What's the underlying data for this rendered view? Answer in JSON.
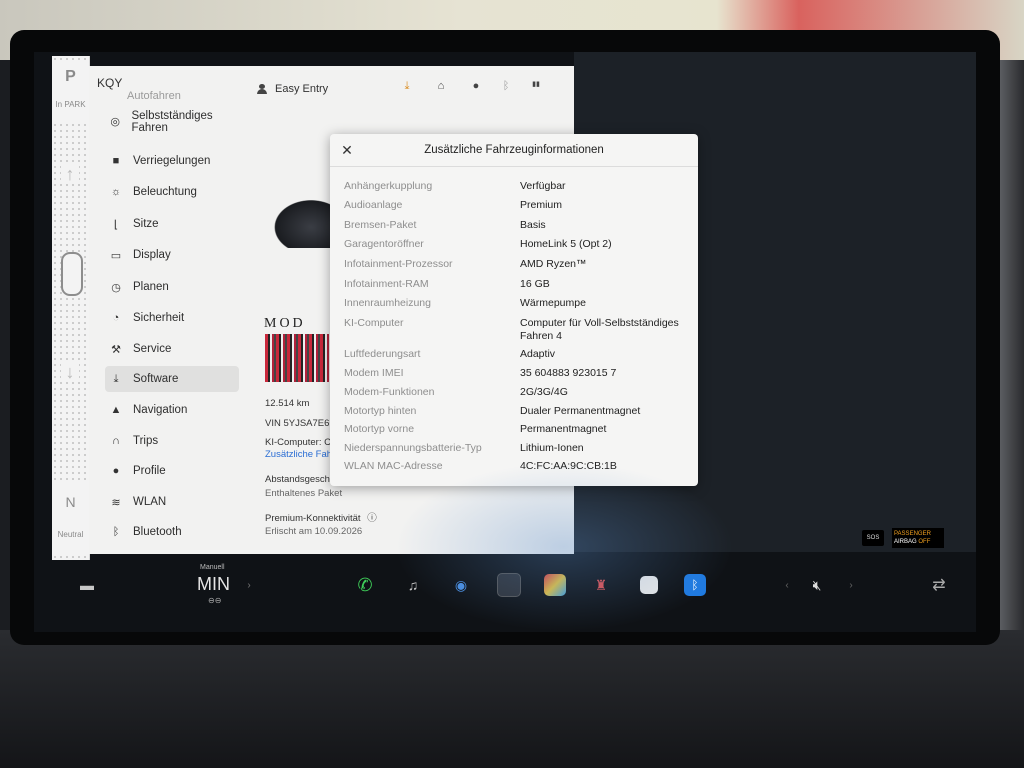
{
  "gear": {
    "park_label": "P",
    "park_sub": "In PARK",
    "neutral_label": "N",
    "neutral_sub": "Neutral"
  },
  "settings": {
    "vehicle_name": "KQY",
    "top_partial": "Autofahren",
    "profile_label": "Easy Entry",
    "menu": [
      {
        "label": "Selbstständiges Fahren",
        "icon": "steering-wheel-icon"
      },
      {
        "label": "Verriegelungen",
        "icon": "lock-icon"
      },
      {
        "label": "Beleuchtung",
        "icon": "light-icon"
      },
      {
        "label": "Sitze",
        "icon": "seat-icon"
      },
      {
        "label": "Display",
        "icon": "display-icon"
      },
      {
        "label": "Planen",
        "icon": "clock-icon"
      },
      {
        "label": "Sicherheit",
        "icon": "shield-icon"
      },
      {
        "label": "Service",
        "icon": "wrench-icon"
      },
      {
        "label": "Software",
        "icon": "download-icon",
        "active": true
      },
      {
        "label": "Navigation",
        "icon": "navigation-icon"
      },
      {
        "label": "Trips",
        "icon": "trips-icon"
      },
      {
        "label": "Profile",
        "icon": "person-icon"
      },
      {
        "label": "WLAN",
        "icon": "wifi-icon"
      },
      {
        "label": "Bluetooth",
        "icon": "bluetooth-icon"
      }
    ],
    "model_logo": "MOD",
    "odometer": "12.514 km",
    "vin": "VIN 5YJSA7E6",
    "ki_computer": "KI-Computer: C",
    "more_info_link": "Zusätzliche Fahr",
    "abstand": "Abstandsgesch",
    "enthalten": "Enthaltenes Paket",
    "premium": "Premium-Konnektivität",
    "expires": "Erlischt am 10.09.2026"
  },
  "dialog": {
    "title": "Zusätzliche Fahrzeuginformationen",
    "rows": [
      {
        "key": "Anhängerkupplung",
        "value": "Verfügbar"
      },
      {
        "key": "Audioanlage",
        "value": "Premium"
      },
      {
        "key": "Bremsen-Paket",
        "value": "Basis"
      },
      {
        "key": "Garagentoröffner",
        "value": "HomeLink 5 (Opt 2)"
      },
      {
        "key": "Infotainment-Prozessor",
        "value": "AMD Ryzen™"
      },
      {
        "key": "Infotainment-RAM",
        "value": "16 GB"
      },
      {
        "key": "Innenraumheizung",
        "value": "Wärmepumpe"
      },
      {
        "key": "KI-Computer",
        "value": "Computer für Voll-Selbstständiges Fahren 4"
      },
      {
        "key": "Luftfederungsart",
        "value": "Adaptiv"
      },
      {
        "key": "Modem IMEI",
        "value": "35 604883 923015 7"
      },
      {
        "key": "Modem-Funktionen",
        "value": "2G/3G/4G"
      },
      {
        "key": "Motortyp hinten",
        "value": "Dualer Permanentmagnet"
      },
      {
        "key": "Motortyp vorne",
        "value": "Permanentmagnet"
      },
      {
        "key": "Niederspannungsbatterie-Typ",
        "value": "Lithium-Ionen"
      },
      {
        "key": "WLAN MAC-Adresse",
        "value": "4C:FC:AA:9C:CB:1B"
      }
    ]
  },
  "taskbar": {
    "fan_mode": "Manuell",
    "fan_value": "MIN",
    "sos": "SOS",
    "airbag_line1": "PASSENGER",
    "airbag_line2": "AIRBAG",
    "airbag_state": "OFF"
  },
  "colors": {
    "link": "#2a6dd4",
    "active_menu": "#e0e0df",
    "panel": "#f2f2f1"
  }
}
